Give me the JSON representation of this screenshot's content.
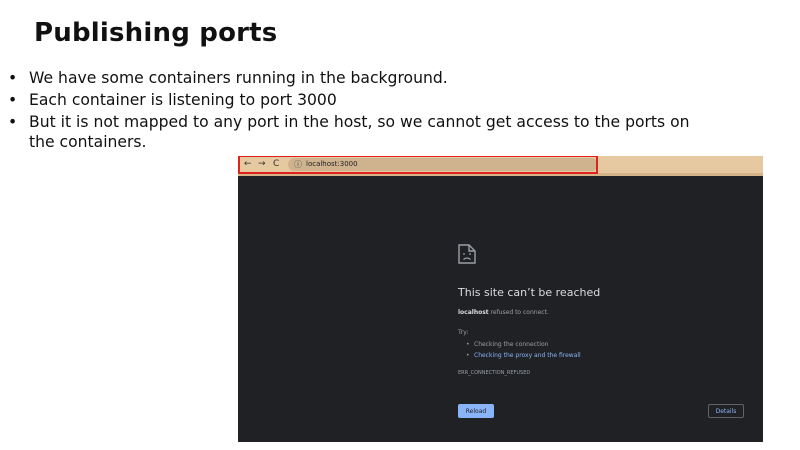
{
  "slide": {
    "title": "Publishing ports",
    "bullets": [
      {
        "text": "We have some containers running in the background."
      },
      {
        "text": "Each container is listening to port 3000"
      },
      {
        "text": "But it is not mapped to any port in the host, so we cannot get access to the ports on",
        "continuation": "the containers."
      }
    ],
    "bullet_glyph": "•"
  },
  "browser": {
    "back_glyph": "←",
    "forward_glyph": "→",
    "reload_glyph": "C",
    "info_glyph": "ⓘ",
    "url": "localhost:3000",
    "highlight_color": "#e0221c",
    "toolbar_color": "#e6c9a1",
    "page_bg": "#202124"
  },
  "error_page": {
    "title": "This site can’t be reached",
    "host": "localhost",
    "message": " refused to connect.",
    "try_label": "Try:",
    "suggestions": [
      {
        "text": "Checking the connection",
        "link": false
      },
      {
        "text": "Checking the proxy and the firewall",
        "link": true
      }
    ],
    "error_code": "ERR_CONNECTION_REFUSED",
    "reload_label": "Reload",
    "details_label": "Details",
    "icon": "sad-document-icon",
    "accent_color": "#8ab4f8"
  }
}
